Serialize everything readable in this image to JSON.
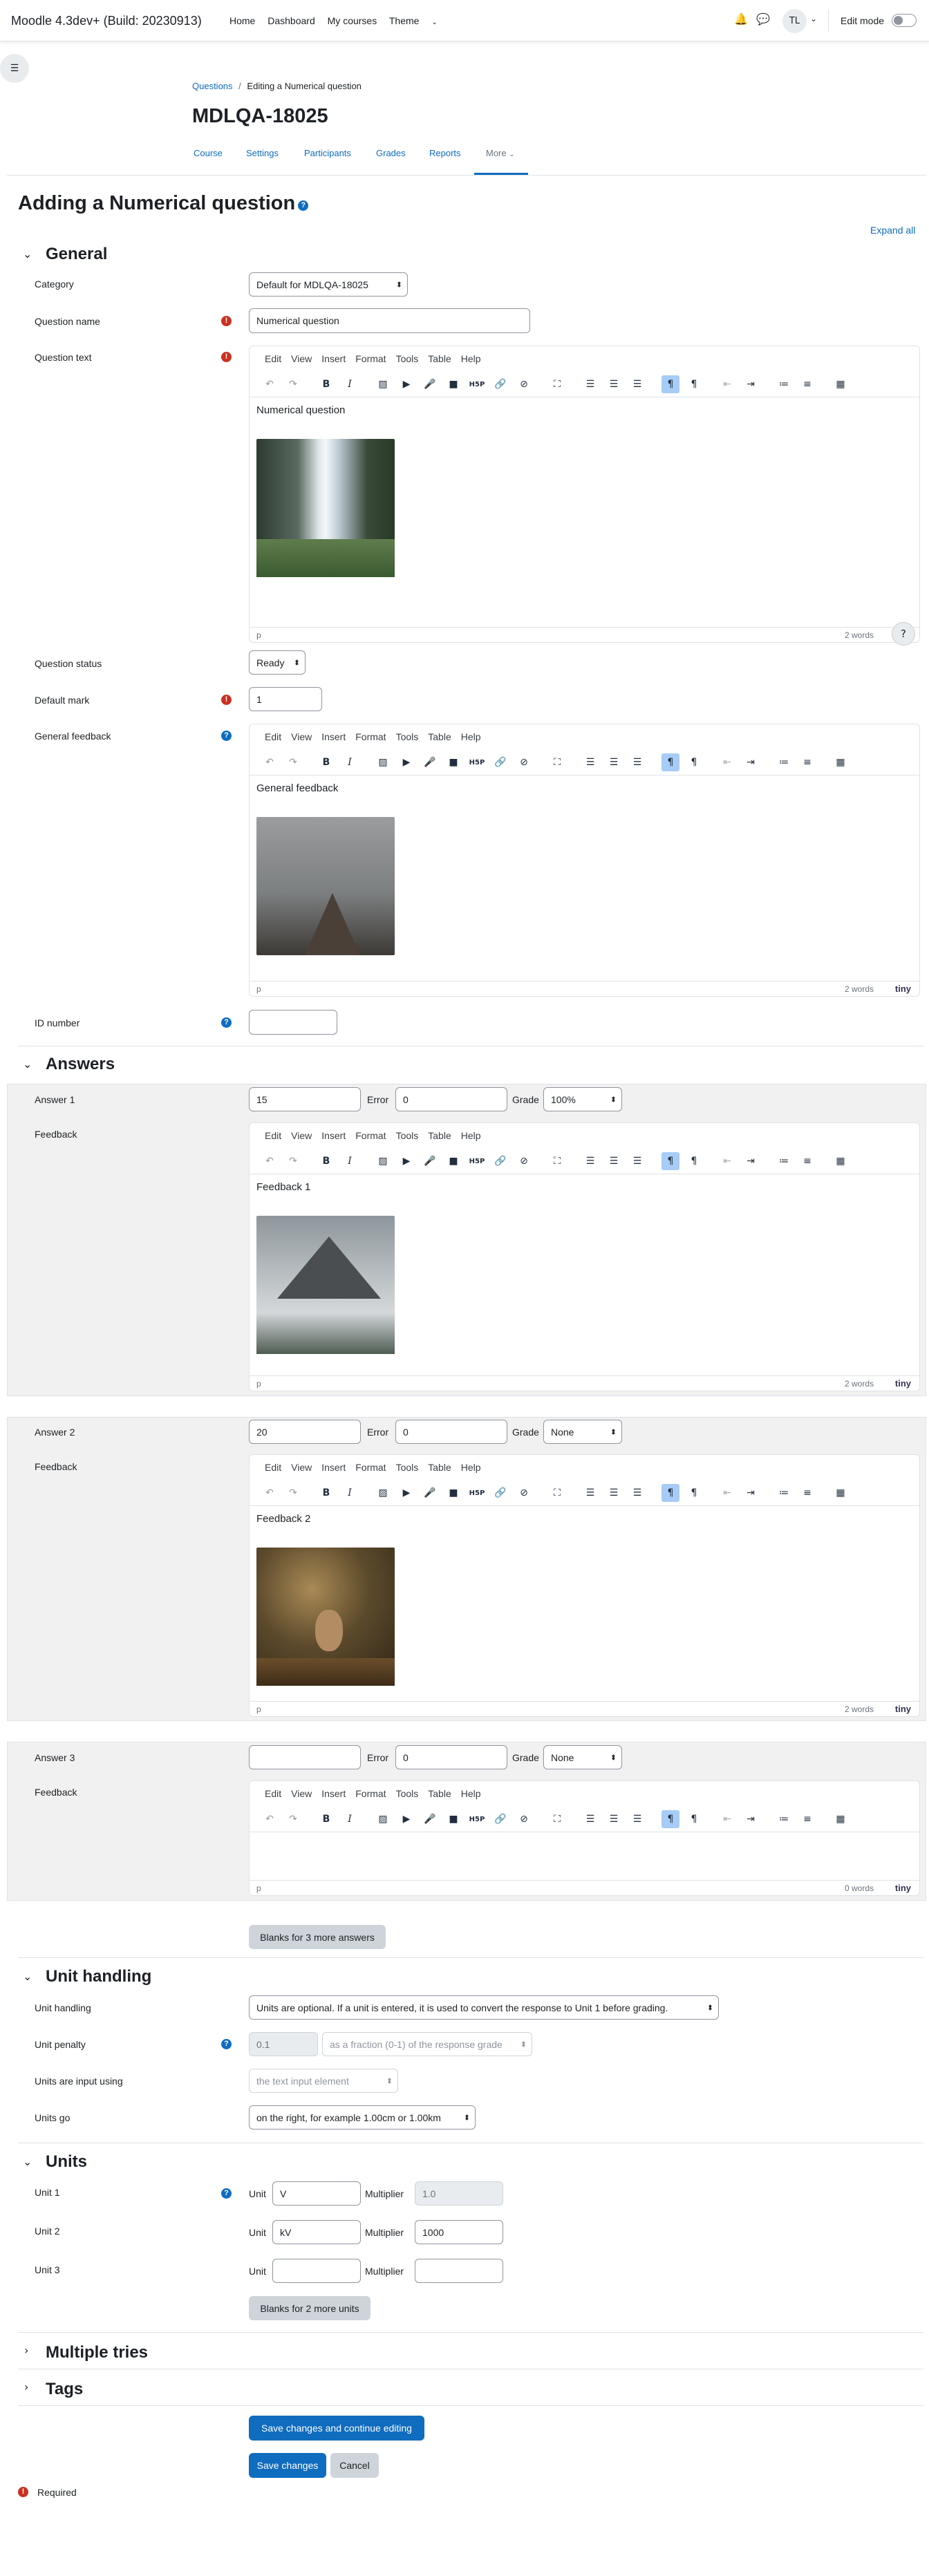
{
  "nav": {
    "brand": "Moodle 4.3dev+ (Build: 20230913)",
    "links": [
      "Home",
      "Dashboard",
      "My courses",
      "Theme"
    ],
    "user_initials": "TL",
    "edit_mode": "Edit mode"
  },
  "breadcrumb": {
    "root": "Questions",
    "sep": "/",
    "current": "Editing a Numerical question"
  },
  "course_title": "MDLQA-18025",
  "course_tabs": [
    "Course",
    "Settings",
    "Participants",
    "Grades",
    "Reports",
    "More"
  ],
  "page_title": "Adding a Numerical question",
  "expand_all": "Expand all",
  "general": {
    "heading": "General",
    "category_label": "Category",
    "category_value": "Default for MDLQA-18025",
    "name_label": "Question name",
    "name_value": "Numerical question",
    "text_label": "Question text",
    "text_content": "Numerical question",
    "status_label": "Question status",
    "status_value": "Ready",
    "mark_label": "Default mark",
    "mark_value": "1",
    "feedback_label": "General feedback",
    "feedback_content": "General feedback",
    "id_label": "ID number",
    "id_value": ""
  },
  "editor": {
    "menu": [
      "Edit",
      "View",
      "Insert",
      "Format",
      "Tools",
      "Table",
      "Help"
    ],
    "path": "p",
    "tiny": "tiny",
    "help_btn": "?"
  },
  "answers": {
    "heading": "Answers",
    "error_label": "Error",
    "grade_label": "Grade",
    "feedback_label": "Feedback",
    "items": [
      {
        "label": "Answer 1",
        "value": "15",
        "error": "0",
        "grade": "100%",
        "feedback": "Feedback 1",
        "words": "2 words"
      },
      {
        "label": "Answer 2",
        "value": "20",
        "error": "0",
        "grade": "None",
        "feedback": "Feedback 2",
        "words": "2 words"
      },
      {
        "label": "Answer 3",
        "value": "",
        "error": "0",
        "grade": "None",
        "feedback": "",
        "words": "0 words"
      }
    ],
    "blanks_button": "Blanks for 3 more answers"
  },
  "text_words": "2 words",
  "feedback_words": "2 words",
  "unit_handling": {
    "heading": "Unit handling",
    "handling_label": "Unit handling",
    "handling_value": "Units are optional. If a unit is entered, it is used to convert the response to Unit 1 before grading.",
    "penalty_label": "Unit penalty",
    "penalty_value": "0.1",
    "penalty_mode": "as a fraction (0-1) of the response grade",
    "input_label": "Units are input using",
    "input_value": "the text input element",
    "go_label": "Units go",
    "go_value": "on the right, for example 1.00cm or 1.00km"
  },
  "units": {
    "heading": "Units",
    "unit_label": "Unit",
    "multiplier_label": "Multiplier",
    "items": [
      {
        "label": "Unit 1",
        "unit": "V",
        "multiplier": "1.0"
      },
      {
        "label": "Unit 2",
        "unit": "kV",
        "multiplier": "1000"
      },
      {
        "label": "Unit 3",
        "unit": "",
        "multiplier": ""
      }
    ],
    "blanks_button": "Blanks for 2 more units"
  },
  "multiple_tries": "Multiple tries",
  "tags": "Tags",
  "buttons": {
    "save_continue": "Save changes and continue editing",
    "save": "Save changes",
    "cancel": "Cancel"
  },
  "required_note": "Required",
  "colors": {
    "primary": "#0f6cbf",
    "required": "#ca3120"
  }
}
